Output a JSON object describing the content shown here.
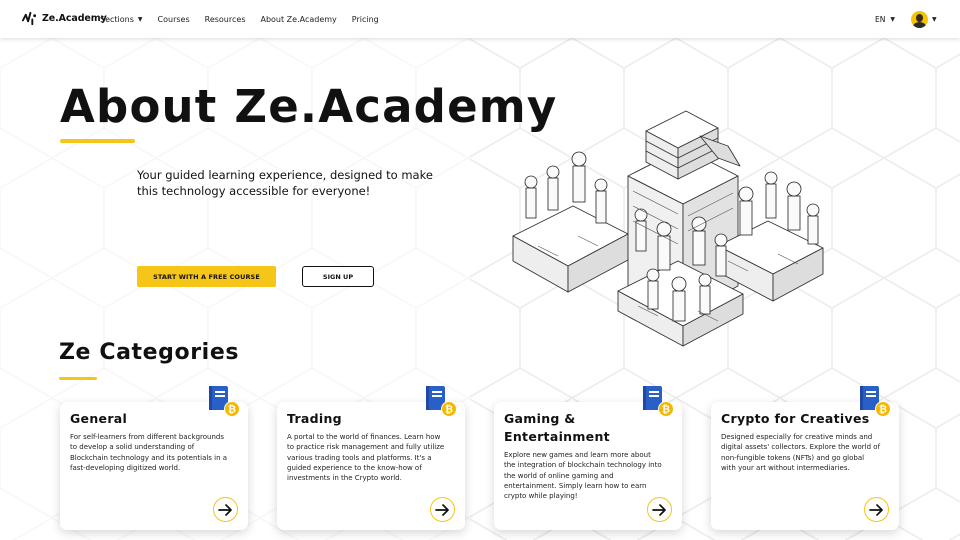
{
  "nav": {
    "logo_text": "Ze.Academy",
    "links": [
      {
        "label": "Sections",
        "has_dropdown": true
      },
      {
        "label": "Courses"
      },
      {
        "label": "Resources"
      },
      {
        "label": "About Ze.Academy"
      },
      {
        "label": "Pricing"
      }
    ],
    "language": "EN"
  },
  "hero": {
    "title": "About Ze.Academy",
    "subtitle": "Your guided learning experience, designed to make this technology accessible for everyone!",
    "primary_button": "START WITH A FREE COURSE",
    "secondary_button": "SIGN UP"
  },
  "categories": {
    "title": "Ze Categories",
    "items": [
      {
        "title": "General",
        "description": "For self-learners from different backgrounds to develop a solid understanding of Blockchain technology and its potentials in a fast-developing digitized world."
      },
      {
        "title": "Trading",
        "description": "A portal to the world of finances. Learn how to practice risk management and fully utilize various trading tools and platforms. It's a guided experience to the know-how of investments in the Crypto world."
      },
      {
        "title": "Gaming & Entertainment",
        "description": "Explore new games and learn more about the integration of blockchain technology into the world of online gaming and entertainment. Simply learn how to earn crypto while playing!"
      },
      {
        "title": "Crypto for Creatives",
        "description": "Designed especially for creative minds and digital assets' collectors. Explore the world of non-fungible tokens (NFTs) and go global with your art without intermediaries."
      }
    ]
  },
  "colors": {
    "accent": "#f5c518",
    "book_blue": "#2a5fc7",
    "coin_gold": "#f5b800",
    "text": "#111111"
  },
  "icons": [
    "ze-logo-icon",
    "chevron-down-icon",
    "user-avatar",
    "book-icon",
    "bitcoin-coin-icon",
    "arrow-right-icon"
  ]
}
